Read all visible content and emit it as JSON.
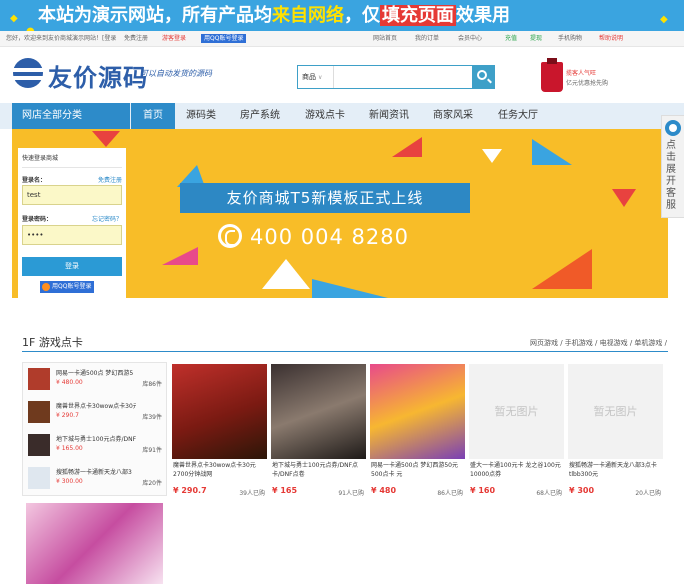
{
  "banner": {
    "part1": "本站为演示网站，所有产品均",
    "hl1": "来自网络",
    "part2": "，仅",
    "hl2": "填充页面",
    "part3": "效果用"
  },
  "topbar": {
    "welcome": "您好，欢迎来到友价商城演示网站！[登录",
    "register": "免费注册",
    "buyer_gift": "游客登录",
    "qq": "用QQ账号登录",
    "links": [
      "网站首页",
      "我的订单",
      "会员中心",
      "充值",
      "提现",
      "手机购物",
      "帮助说明"
    ]
  },
  "header": {
    "logo": "友价源码",
    "slogan": "可以自动发货的源码",
    "search_category": "商品",
    "ad_line1": "揽客人气旺",
    "ad_line2": "亿元优惠抢先购"
  },
  "nav": {
    "all": "网店全部分类",
    "items": [
      "首页",
      "源码类",
      "房产系统",
      "游戏点卡",
      "新闻资讯",
      "商家风采",
      "任务大厅"
    ]
  },
  "hero": {
    "title": "友价商城T5新模板正式上线",
    "phone": "400 004 8280"
  },
  "login": {
    "title": "快速登录商城",
    "user_label": "登录名：",
    "register_link": "免费注册",
    "user_value": "test",
    "pwd_label": "登录密码：",
    "forgot_link": "忘记密码？",
    "pwd_value": "••••",
    "submit": "登录",
    "qq": "用QQ账号登录"
  },
  "side": {
    "text": "点击展开客服"
  },
  "section": {
    "title": "1F 游戏点卡",
    "links": "网页游戏 / 手机游戏 / 电视游戏 / 单机游戏 /"
  },
  "list": [
    {
      "name": "网易一卡通500点 梦幻西游5",
      "price": "¥ 480.00",
      "stock": "库86件",
      "thumb": "#b03c2b"
    },
    {
      "name": "魔兽世界点卡30wow点卡30元",
      "price": "¥ 290.7",
      "stock": "库39件",
      "thumb": "#6f3a1e"
    },
    {
      "name": "地下城与勇士100元点券/DNF",
      "price": "¥ 165.00",
      "stock": "库91件",
      "thumb": "#3a2c2a"
    },
    {
      "name": "搜狐畅游一卡通新天龙八部3",
      "price": "¥ 300.00",
      "stock": "库20件",
      "thumb": "#dfe7ef"
    }
  ],
  "cards": [
    {
      "name": "魔兽世界点卡30wow点卡30元2700分钟战网",
      "price": "¥ 290.7",
      "sold": "39人已购",
      "bg": "linear-gradient(160deg,#c0302b,#7a1a12 55%,#2c1608)",
      "noimg": ""
    },
    {
      "name": "地下城与勇士100元点券/DNF点卡/DNF点卷",
      "price": "¥ 165",
      "sold": "91人已购",
      "bg": "linear-gradient(160deg,#3a3030,#8a7a6e 50%,#1e1a18)",
      "noimg": ""
    },
    {
      "name": "网易一卡通500点 梦幻西游50元500点卡 元",
      "price": "¥ 480",
      "sold": "86人已购",
      "bg": "linear-gradient(160deg,#e84a8a,#f7b731 50%,#7a3fb5)",
      "noimg": ""
    },
    {
      "name": "盛大一卡通100元卡 龙之谷100元10000点券",
      "price": "¥ 160",
      "sold": "68人已购",
      "bg": "#f2f2f2",
      "noimg": "暂无图片"
    },
    {
      "name": "搜狐畅游一卡通新天龙八部3点卡tlbb300元",
      "price": "¥ 300",
      "sold": "20人已购",
      "bg": "#f2f2f2",
      "noimg": "暂无图片"
    }
  ]
}
